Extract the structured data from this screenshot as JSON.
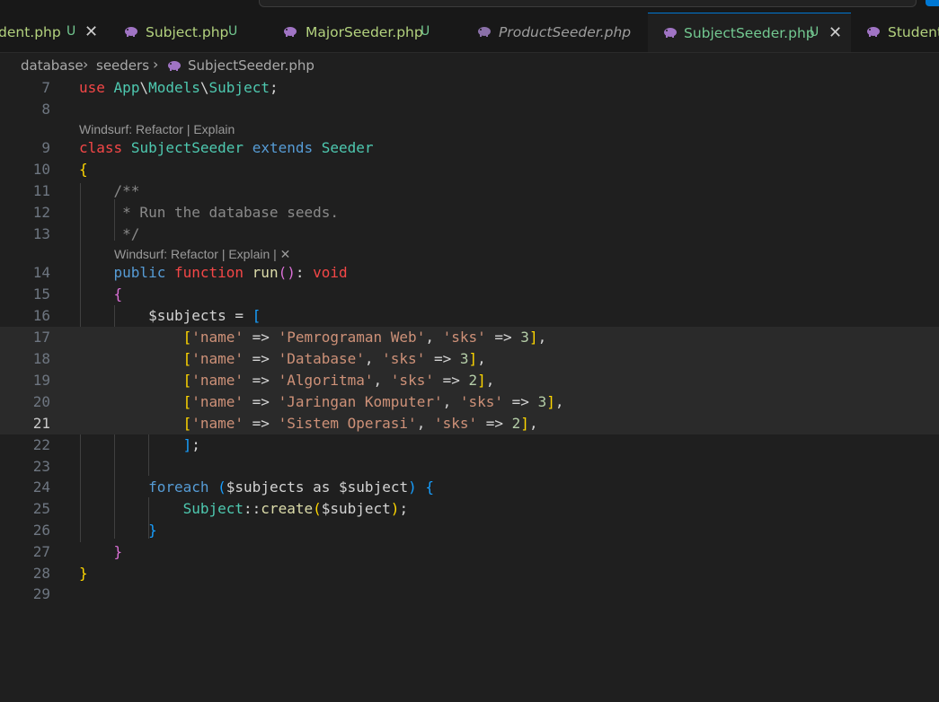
{
  "tabs": [
    {
      "label": "dent.php",
      "status": "U",
      "close": "✕",
      "active": false
    },
    {
      "label": "Subject.php",
      "status": "U",
      "active": false
    },
    {
      "label": "MajorSeeder.php",
      "status": "U",
      "active": false
    },
    {
      "label": "ProductSeeder.php",
      "status": "",
      "active": false,
      "italic": true
    },
    {
      "label": "SubjectSeeder.php",
      "status": "U",
      "close": "✕",
      "active": true
    },
    {
      "label": "Student",
      "status": "",
      "active": false
    }
  ],
  "breadcrumb": {
    "folder1": "database",
    "sep": "›",
    "folder2": "seeders",
    "file": "SubjectSeeder.php"
  },
  "codelens": {
    "class_lens": "Windsurf: Refactor | Explain",
    "method_lens": "Windsurf: Refactor | Explain | ✕"
  },
  "lines": [
    {
      "n": "7",
      "code": "use App\\Models\\Subject;"
    },
    {
      "n": "8",
      "code": ""
    },
    {
      "n": "9",
      "code": "class SubjectSeeder extends Seeder"
    },
    {
      "n": "10",
      "code": "{"
    },
    {
      "n": "11",
      "code": "    /**"
    },
    {
      "n": "12",
      "code": "     * Run the database seeds."
    },
    {
      "n": "13",
      "code": "     */"
    },
    {
      "n": "14",
      "code": "    public function run(): void"
    },
    {
      "n": "15",
      "code": "    {"
    },
    {
      "n": "16",
      "code": "        $subjects = ["
    },
    {
      "n": "17",
      "code": "            ['name' => 'Pemrograman Web', 'sks' => 3],"
    },
    {
      "n": "18",
      "code": "            ['name' => 'Database', 'sks' => 3],"
    },
    {
      "n": "19",
      "code": "            ['name' => 'Algoritma', 'sks' => 2],"
    },
    {
      "n": "20",
      "code": "            ['name' => 'Jaringan Komputer', 'sks' => 3],"
    },
    {
      "n": "21",
      "code": "            ['name' => 'Sistem Operasi', 'sks' => 2],"
    },
    {
      "n": "22",
      "code": "            ];"
    },
    {
      "n": "23",
      "code": ""
    },
    {
      "n": "24",
      "code": "        foreach ($subjects as $subject) {"
    },
    {
      "n": "25",
      "code": "            Subject::create($subject);"
    },
    {
      "n": "26",
      "code": "        }"
    },
    {
      "n": "27",
      "code": "    }"
    },
    {
      "n": "28",
      "code": "}"
    },
    {
      "n": "29",
      "code": ""
    }
  ],
  "subjects": [
    {
      "name": "Pemrograman Web",
      "sks": 3
    },
    {
      "name": "Database",
      "sks": 3
    },
    {
      "name": "Algoritma",
      "sks": 2
    },
    {
      "name": "Jaringan Komputer",
      "sks": 3
    },
    {
      "name": "Sistem Operasi",
      "sks": 2
    }
  ],
  "colors": {
    "editor_bg": "#1f1f1f",
    "accent": "#0078d4",
    "untracked": "#73c991"
  }
}
